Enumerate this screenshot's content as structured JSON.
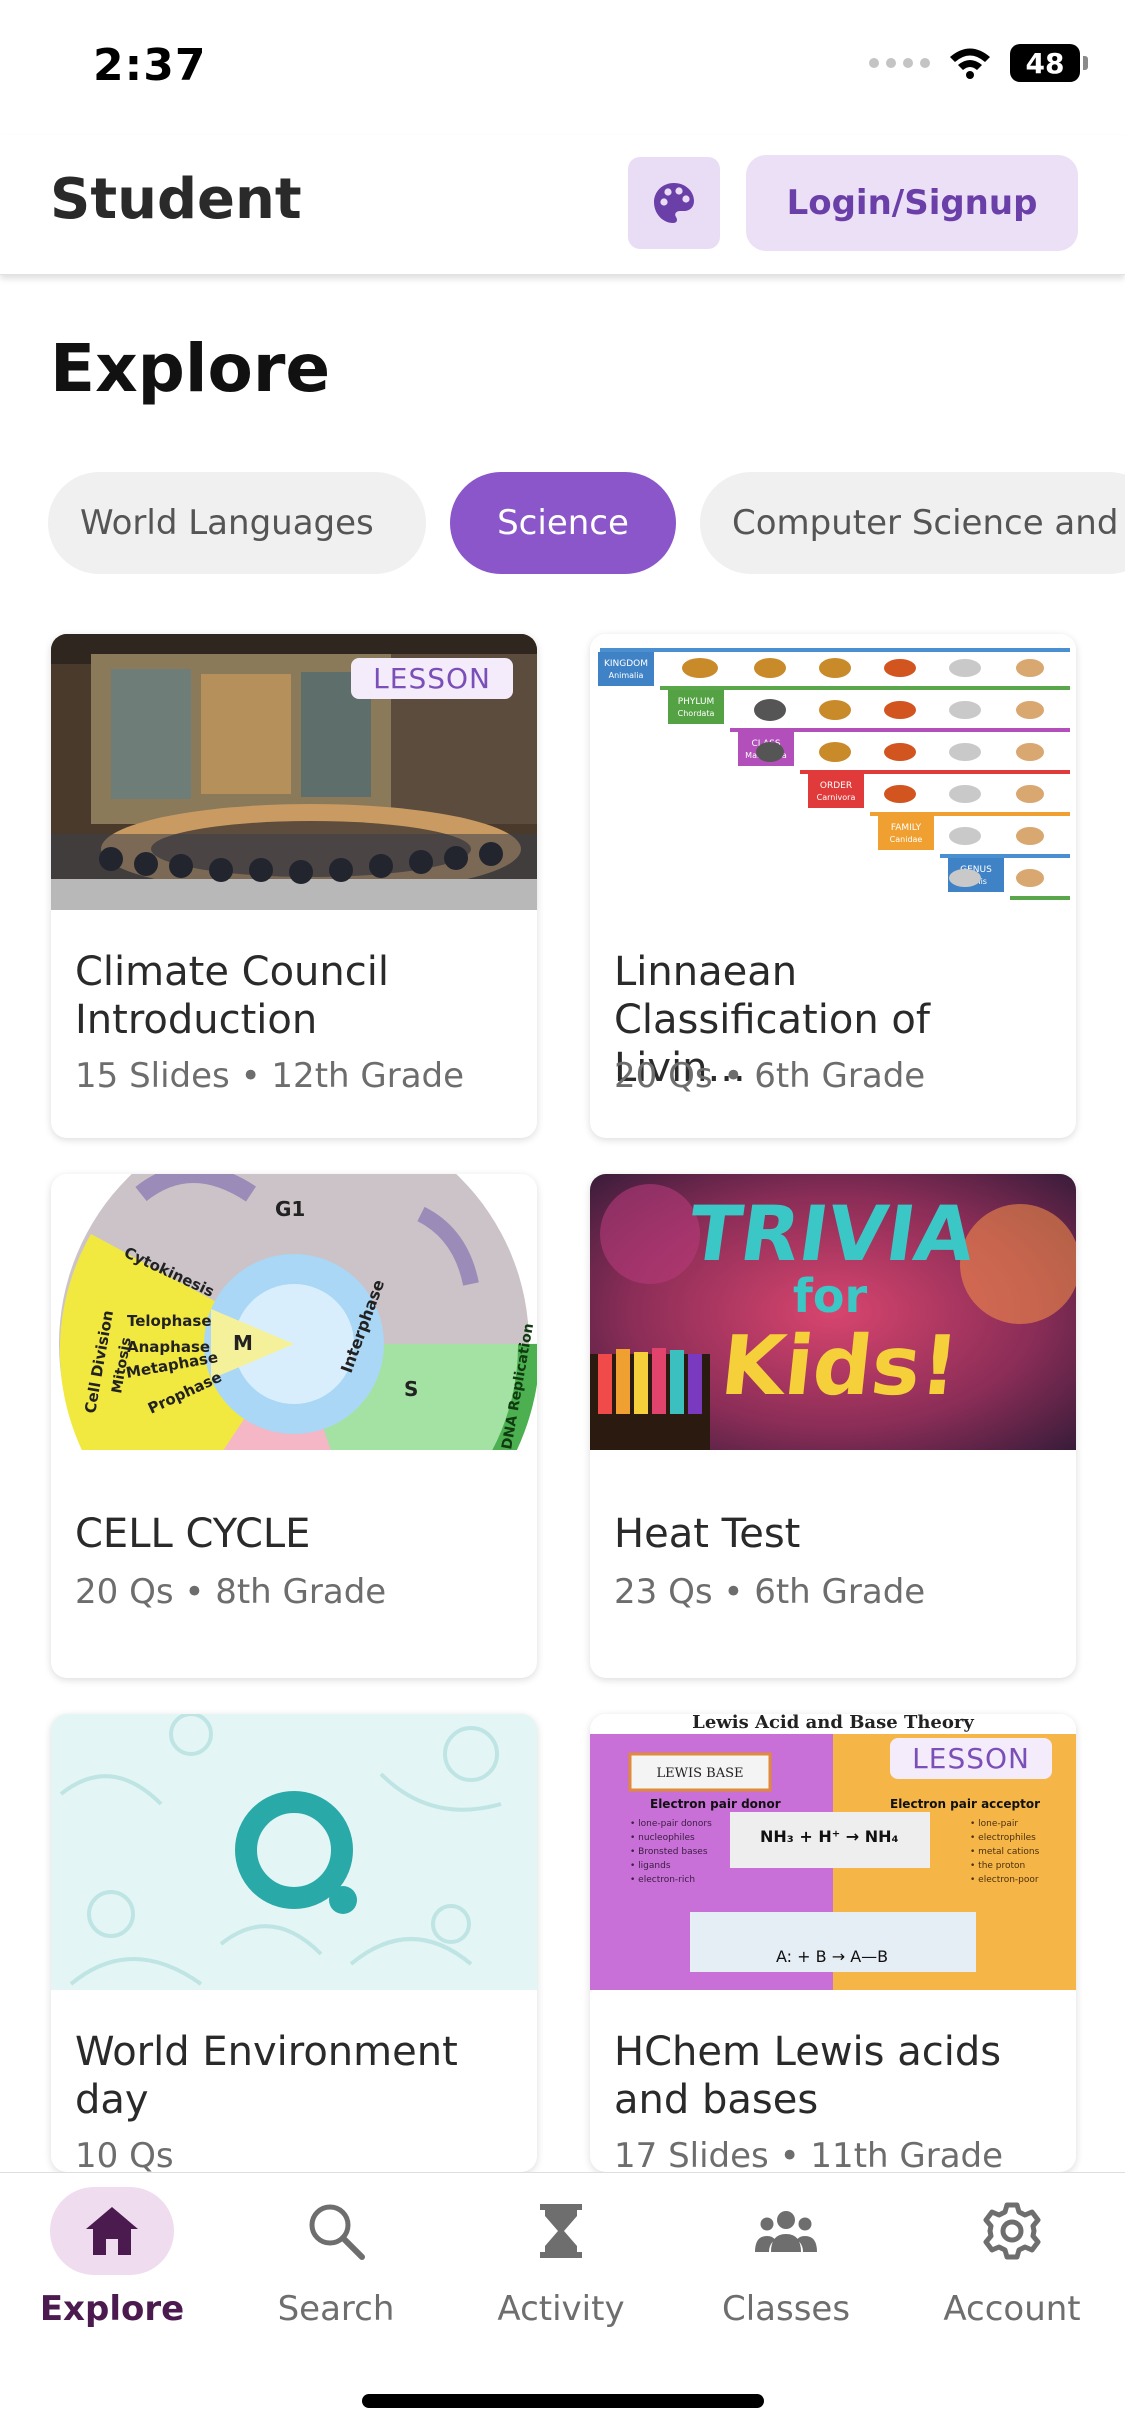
{
  "status_bar": {
    "time": "2:37",
    "battery": "48"
  },
  "header": {
    "title": "Student",
    "palette_icon": "palette-icon",
    "login_label": "Login/Signup"
  },
  "page": {
    "title": "Explore"
  },
  "chips": [
    {
      "label": "World Languages",
      "active": false
    },
    {
      "label": "Science",
      "active": true
    },
    {
      "label": "Computer Science and",
      "active": false
    }
  ],
  "cards": [
    {
      "title": "Climate Council Introduction",
      "meta": "15 Slides • 12th Grade",
      "badge": "LESSON"
    },
    {
      "title": "Linnaean Classification of Livin...",
      "meta": "20 Qs • 6th Grade",
      "badge": "",
      "thumb_labels": [
        "KINGDOM",
        "Animalia",
        "PHYLUM",
        "Chordata",
        "CLASS",
        "Mammalia",
        "ORDER",
        "Carnivora",
        "FAMILY",
        "Canidae",
        "GENUS",
        "Canis"
      ]
    },
    {
      "title": "CELL CYCLE",
      "meta": "20 Qs • 8th Grade",
      "badge": "",
      "thumb_labels": [
        "G1",
        "M",
        "S",
        "Interphase",
        "Cytokinesis",
        "Telophase",
        "Anaphase",
        "Metaphase",
        "Prophase",
        "Cell Division",
        "Mitosis",
        "DNA Replication"
      ]
    },
    {
      "title": "Heat Test",
      "meta": "23 Qs • 6th Grade",
      "badge": "",
      "thumb_labels": [
        "TRIVIA",
        "for",
        "Kids!"
      ]
    },
    {
      "title": "World Environment day",
      "meta": "10 Qs",
      "badge": ""
    },
    {
      "title": "HChem Lewis acids and bases",
      "meta": "17 Slides • 11th Grade",
      "badge": "LESSON",
      "thumb_labels": [
        "Lewis Acid and Base Theory",
        "LEWIS BASE",
        "Electron pair donor",
        "Electron pair acceptor",
        "A: + B → A—B"
      ]
    }
  ],
  "nav": [
    {
      "label": "Explore",
      "icon": "home-icon",
      "active": true
    },
    {
      "label": "Search",
      "icon": "search-icon",
      "active": false
    },
    {
      "label": "Activity",
      "icon": "hourglass-icon",
      "active": false
    },
    {
      "label": "Classes",
      "icon": "people-icon",
      "active": false
    },
    {
      "label": "Account",
      "icon": "gear-icon",
      "active": false
    }
  ],
  "colors": {
    "accent": "#8a56c9",
    "nav_active": "#4b1a4f",
    "login_bg": "#ebe0f6"
  }
}
